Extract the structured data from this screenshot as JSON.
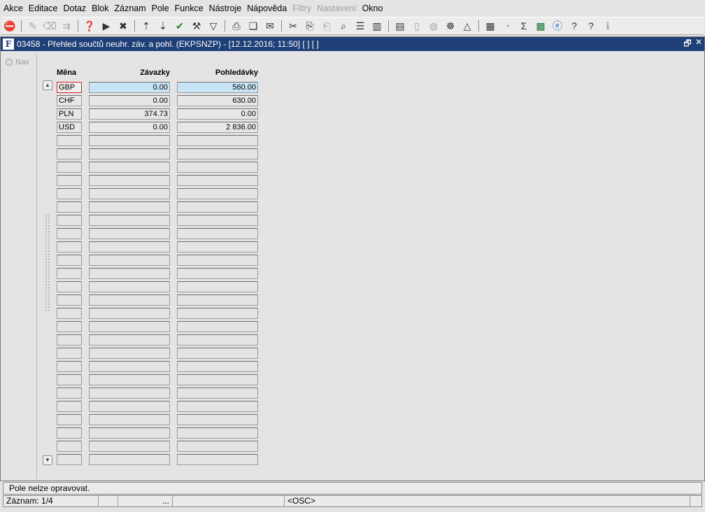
{
  "menu": [
    "Akce",
    "Editace",
    "Dotaz",
    "Blok",
    "Záznam",
    "Pole",
    "Funkce",
    "Nástroje",
    "Nápověda",
    "Filtry",
    "Nastavení",
    "Okno"
  ],
  "menu_disabled": [
    "Filtry",
    "Nastavení"
  ],
  "toolbar_icons": [
    "exit-icon",
    "insert-record-icon",
    "delete-record-icon",
    "duplicate-record-icon",
    "query-enter-icon",
    "query-execute-icon",
    "query-cancel-icon",
    "sort-ascending-icon",
    "sort-descending-icon",
    "commit-check-icon",
    "wrench-icon",
    "filter-icon",
    "print-icon",
    "print-preview-icon",
    "mail-icon",
    "cut-icon",
    "copy-icon",
    "paste-icon",
    "find-icon",
    "list-icon",
    "columns-icon",
    "clipboard-icon",
    "document-icon",
    "globe-icon",
    "settings-wheel-icon",
    "triangle-icon",
    "report-icon",
    "chart-icon",
    "sigma-icon",
    "excel-icon",
    "internet-explorer-icon",
    "help-lock-icon",
    "help-icon",
    "info-icon"
  ],
  "window": {
    "title": "03458 - Přehled součtů neuhr. záv. a pohl. (EKPSNZP) - [12.12.2016; 11:50]  [ ] [ ]",
    "restore_glyph": "🗗",
    "close_glyph": "✕",
    "logo": "F"
  },
  "nav": {
    "label": "Nav"
  },
  "grid": {
    "headers": {
      "currency": "Měna",
      "liabilities": "Závazky",
      "receivables": "Pohledávky"
    },
    "rows": [
      {
        "currency": "GBP",
        "liabilities": "0.00",
        "receivables": "560.00"
      },
      {
        "currency": "CHF",
        "liabilities": "0.00",
        "receivables": "630.00"
      },
      {
        "currency": "PLN",
        "liabilities": "374.73",
        "receivables": "0.00"
      },
      {
        "currency": "USD",
        "liabilities": "0.00",
        "receivables": "2 836.00"
      }
    ],
    "total_visible_rows": 29
  },
  "status": {
    "message": "Pole nelze opravovat.",
    "record": "Záznam: 1/4",
    "ellipsis": "...",
    "mode": "<OSC>"
  }
}
